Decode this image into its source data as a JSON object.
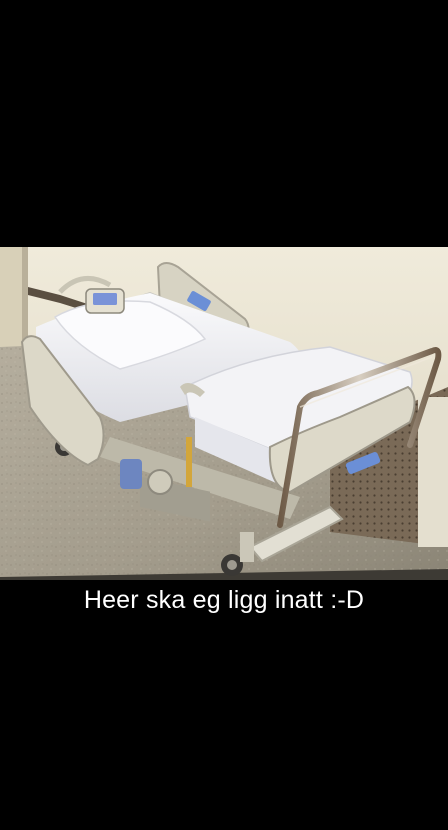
{
  "photo": {
    "subject": "hospital-bed-photo"
  },
  "caption": {
    "text": "Heer ska eg ligg inatt :-D"
  },
  "colors": {
    "background": "#000000",
    "caption_text": "#ffffff",
    "wall": "#e9e4d3",
    "floor": "#a39d8e",
    "bed_frame": "#d9d6c6",
    "sheets": "#f4f4f6",
    "accent_blue": "#5f7fc2"
  }
}
